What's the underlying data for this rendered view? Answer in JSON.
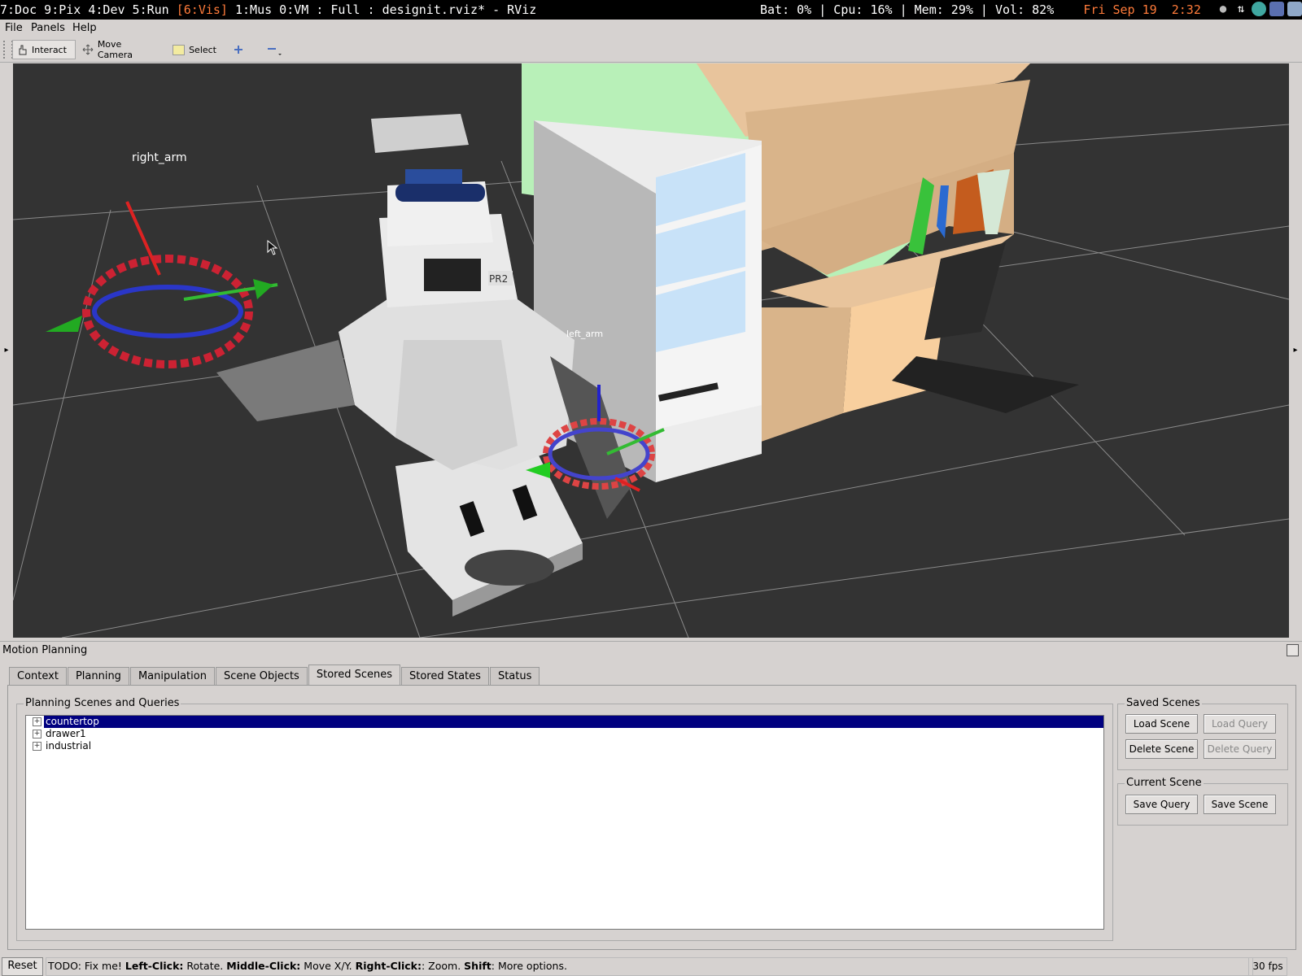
{
  "topbar": {
    "workspaces_pre": "7:Doc 9:Pix 4:Dev 5:Run ",
    "active_workspace": "[6:Vis]",
    "workspaces_post": " 1:Mus 0:VM : Full : designit.rviz* - RViz",
    "status_pre": "Bat: 0% | Cpu: 16% | Mem: 29% | Vol: 82%    ",
    "datetime": "Fri Sep 19  2:32"
  },
  "menu": {
    "file": "File",
    "panels": "Panels",
    "help": "Help"
  },
  "toolbar": {
    "interact": "Interact",
    "move_camera": "Move Camera",
    "select": "Select"
  },
  "viewport": {
    "right_arm_label": "right_arm",
    "left_arm_label": "left_arm",
    "robot_label": "PR2"
  },
  "panel": {
    "title": "Motion Planning",
    "tabs": [
      "Context",
      "Planning",
      "Manipulation",
      "Scene Objects",
      "Stored Scenes",
      "Stored States",
      "Status"
    ],
    "active_tab": "Stored Scenes",
    "scenes_group": "Planning Scenes and Queries",
    "scenes": [
      "countertop",
      "drawer1",
      "industrial"
    ],
    "selected_scene": "countertop",
    "saved_group": "Saved Scenes",
    "load_scene": "Load Scene",
    "load_query": "Load Query",
    "delete_scene": "Delete Scene",
    "delete_query": "Delete Query",
    "current_group": "Current Scene",
    "save_query": "Save Query",
    "save_scene": "Save Scene"
  },
  "statusbar": {
    "reset": "Reset",
    "hint_intro": "TODO: Fix me! ",
    "left_key": "Left-Click:",
    "left_desc": " Rotate. ",
    "middle_key": "Middle-Click:",
    "middle_desc": " Move X/Y. ",
    "right_key": "Right-Click:",
    "right_desc": ": Zoom. ",
    "shift_key": "Shift",
    "shift_desc": ": More options.",
    "fps": "30 fps"
  },
  "colors": {
    "highlight": "#000080",
    "accent_orange": "#ff7b3a"
  }
}
